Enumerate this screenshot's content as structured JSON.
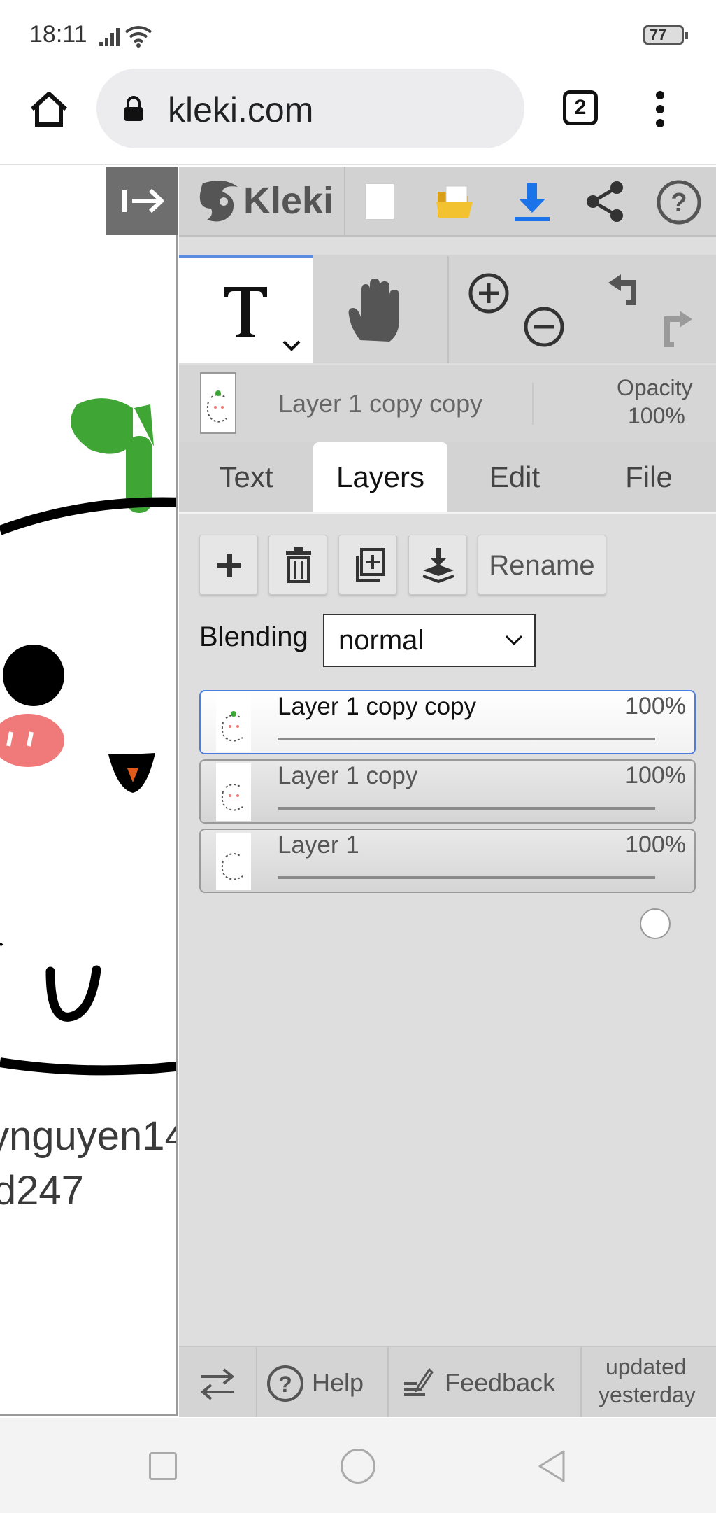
{
  "status_bar": {
    "time": "18:11",
    "battery": "77"
  },
  "browser": {
    "url": "kleki.com",
    "tab_count": "2"
  },
  "canvas": {
    "text_line1": "ynguyen14",
    "text_line2": "ld247"
  },
  "toolbar": {
    "logo_text": "Kleki"
  },
  "layer_info": {
    "current_layer": "Layer 1 copy copy",
    "opacity_label": "Opacity",
    "opacity_value": "100%"
  },
  "tabs": [
    {
      "label": "Text"
    },
    {
      "label": "Layers"
    },
    {
      "label": "Edit"
    },
    {
      "label": "File"
    }
  ],
  "layer_buttons": {
    "rename_label": "Rename"
  },
  "blending": {
    "label": "Blending",
    "value": "normal"
  },
  "layers": [
    {
      "name": "Layer 1 copy copy",
      "opacity": "100%",
      "opacity_fraction": 1.0,
      "active": true
    },
    {
      "name": "Layer 1 copy",
      "opacity": "100%",
      "opacity_fraction": 1.0,
      "active": false
    },
    {
      "name": "Layer 1",
      "opacity": "100%",
      "opacity_fraction": 1.0,
      "active": false
    }
  ],
  "bottom_bar": {
    "help_label": "Help",
    "feedback_label": "Feedback",
    "updated_line1": "updated",
    "updated_line2": "yesterday"
  },
  "colors": {
    "accent_blue": "#4a7fe0",
    "download_blue": "#1a73e8",
    "folder_yellow": "#f2c230",
    "leaf_green": "#3fa535",
    "cheek_pink": "#f07a7a"
  }
}
